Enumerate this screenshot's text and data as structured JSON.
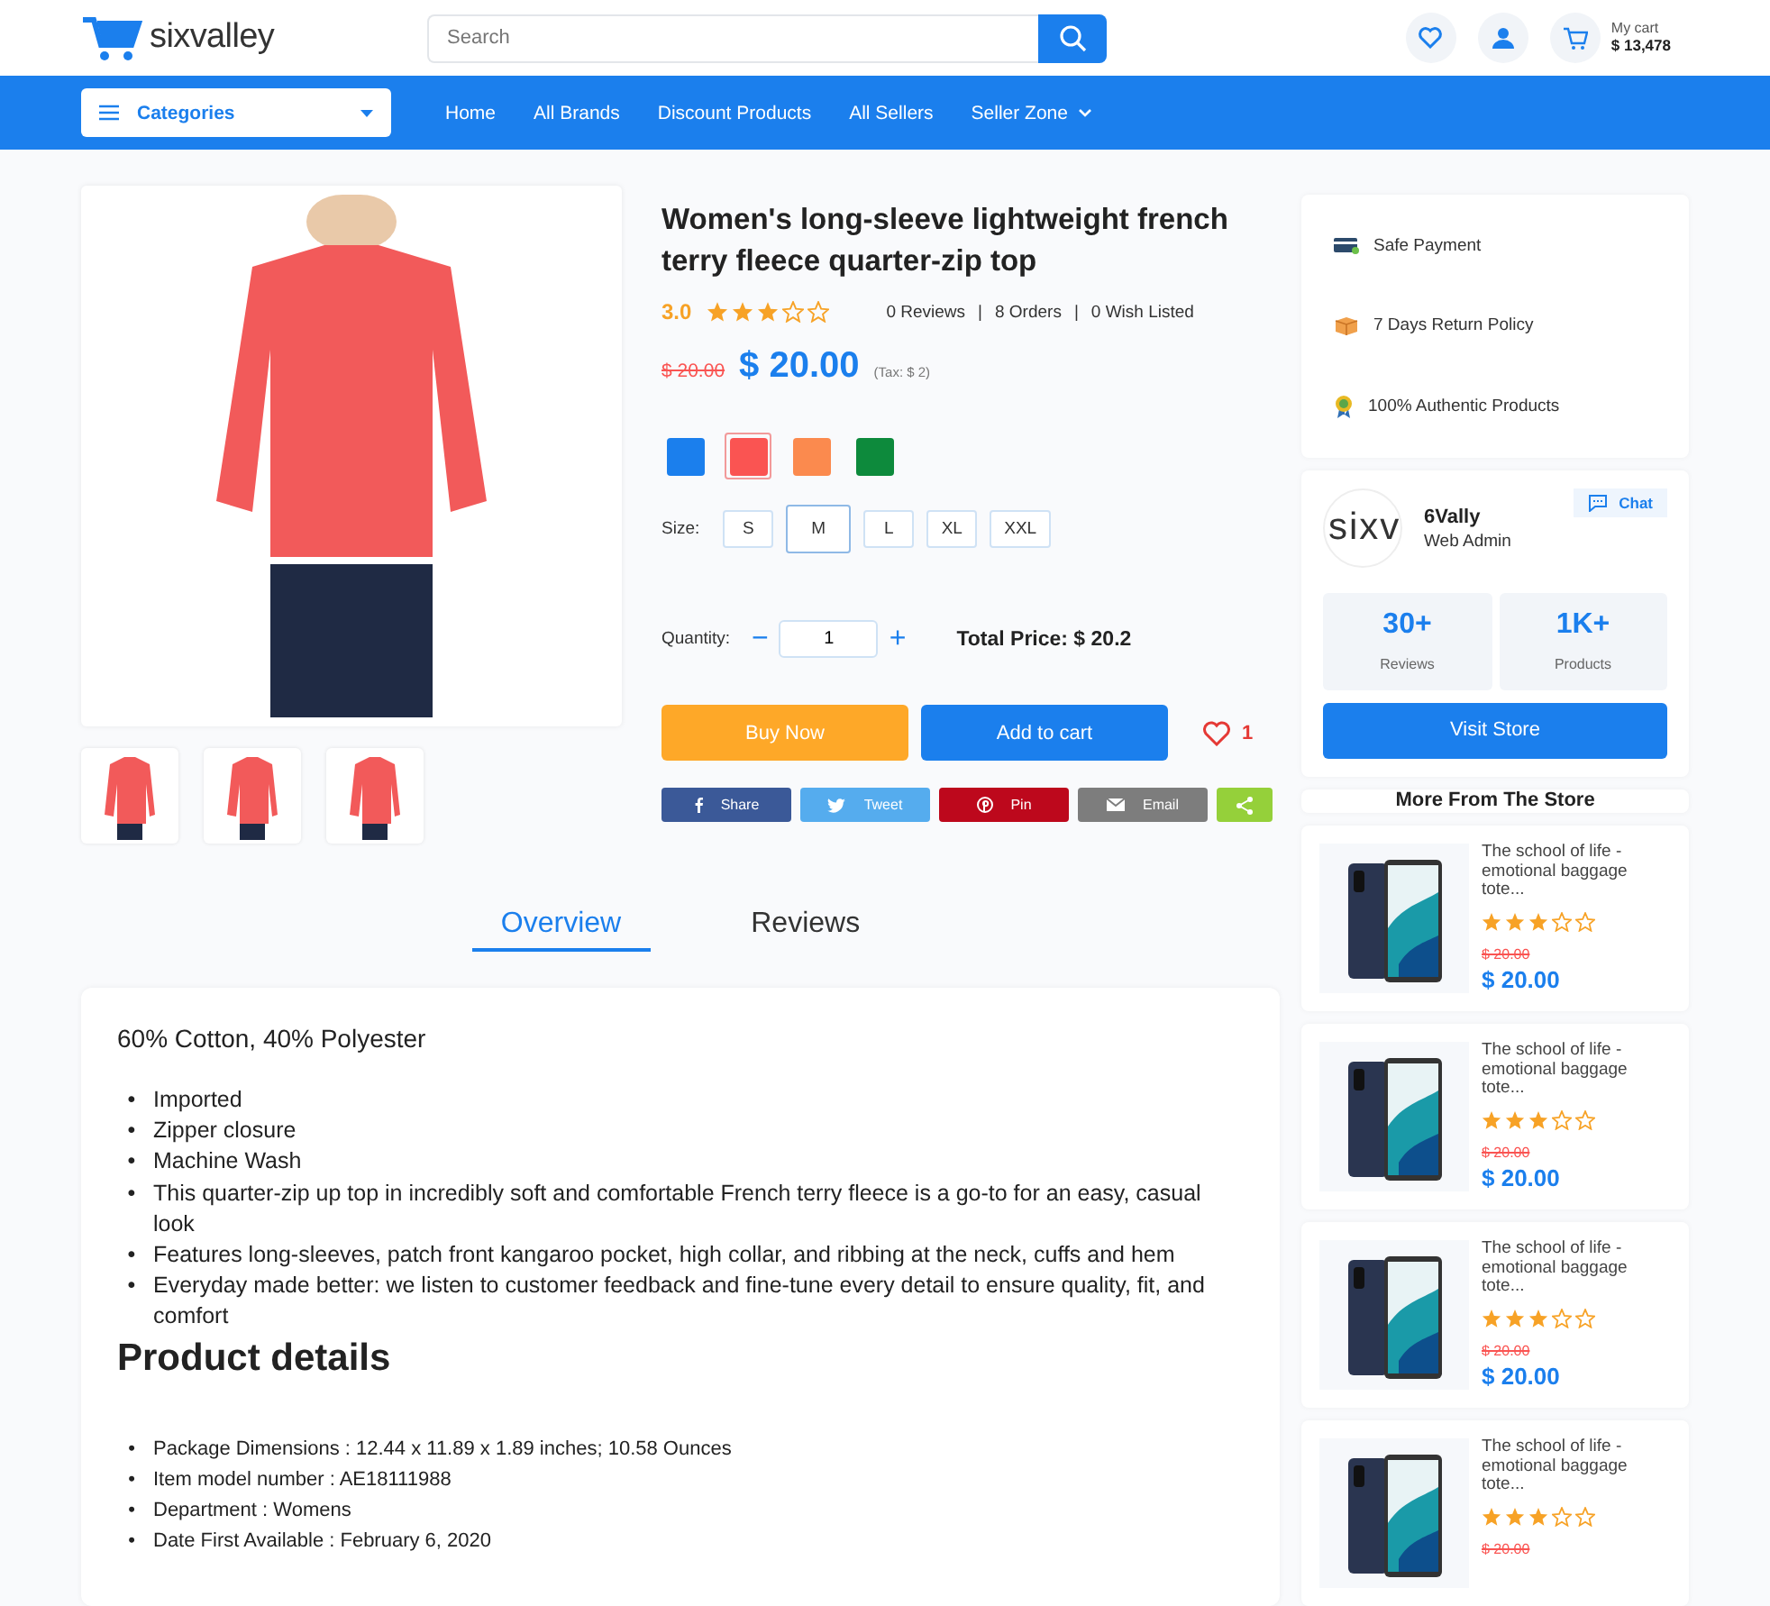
{
  "header": {
    "logo_text": "sixvalley",
    "search": {
      "placeholder": "Search"
    },
    "cart": {
      "label": "My cart",
      "amount": "$ 13,478"
    }
  },
  "nav": {
    "categories": "Categories",
    "links": [
      {
        "label": "Home",
        "dropdown": false
      },
      {
        "label": "All Brands",
        "dropdown": false
      },
      {
        "label": "Discount Products",
        "dropdown": false
      },
      {
        "label": "All Sellers",
        "dropdown": false
      },
      {
        "label": "Seller Zone",
        "dropdown": true
      }
    ]
  },
  "product": {
    "title": "Women's long-sleeve lightweight french terry fleece quarter-zip top",
    "rating": "3.0",
    "stars": 3,
    "stats": [
      "0 Reviews",
      "8 Orders",
      "0 Wish Listed"
    ],
    "stat_separator": "|",
    "old_price": "$ 20.00",
    "price": "$ 20.00",
    "tax": "(Tax: $ 2)",
    "colors": [
      {
        "color": "#1b7fed",
        "selected": false
      },
      {
        "color": "#fa5452",
        "selected": true
      },
      {
        "color": "#fb8a4e",
        "selected": false
      },
      {
        "color": "#0d8a3c",
        "selected": false
      }
    ],
    "size_label": "Size:",
    "sizes": [
      {
        "label": "S",
        "selected": false
      },
      {
        "label": "M",
        "selected": true
      },
      {
        "label": "L",
        "selected": false
      },
      {
        "label": "XL",
        "selected": false
      },
      {
        "label": "XXL",
        "selected": false
      }
    ],
    "quantity_label": "Quantity:",
    "quantity": "1",
    "minus": "−",
    "plus": "+",
    "total": "Total Price: $ 20.2",
    "buy_now": "Buy Now",
    "add_to_cart": "Add to cart",
    "wishlist_count": "1",
    "share": [
      {
        "kind": "facebook",
        "label": "Share",
        "color": "#3b5998"
      },
      {
        "kind": "twitter",
        "label": "Tweet",
        "color": "#55acee"
      },
      {
        "kind": "pinterest",
        "label": "Pin",
        "color": "#bd081c"
      },
      {
        "kind": "email",
        "label": "Email",
        "color": "#7d7d7d"
      },
      {
        "kind": "share",
        "color": "#95d03a"
      }
    ]
  },
  "tabs": [
    {
      "label": "Overview",
      "selected": true
    },
    {
      "label": "Reviews",
      "selected": false
    }
  ],
  "description": {
    "bullet": "•",
    "heading": "60% Cotton, 40% Polyester",
    "bullets": [
      "Imported",
      "Zipper closure",
      "Machine Wash",
      "This quarter-zip up top in incredibly soft and comfortable French terry fleece is a go-to for an easy, casual look",
      "Features long-sleeves, patch front kangaroo pocket, high collar, and ribbing at the neck, cuffs and hem",
      "Everyday made better: we listen to customer feedback and fine-tune every detail to ensure quality, fit, and comfort"
    ],
    "details_heading": "Product details",
    "details": [
      "Package Dimensions : 12.44 x 11.89 x 1.89 inches; 10.58 Ounces",
      "Item model number : AE18111988",
      "Department : Womens",
      "Date First Available : February 6, 2020"
    ]
  },
  "features": [
    {
      "kind": "payment",
      "label": "Safe Payment"
    },
    {
      "kind": "return",
      "label": "7 Days Return Policy"
    },
    {
      "kind": "authentic",
      "label": "100% Authentic Products"
    }
  ],
  "store": {
    "logo_text": "sixv",
    "name": "6Vally",
    "role": "Web Admin",
    "chat": "Chat",
    "stats": [
      {
        "value": "30+",
        "label": "Reviews"
      },
      {
        "value": "1K+",
        "label": "Products"
      }
    ],
    "visit": "Visit Store"
  },
  "more_title": "More From The Store",
  "more_items": [
    {
      "name": "The school of life - emotional baggage tote...",
      "stars": 3,
      "old_price": "$ 20.00",
      "price": "$ 20.00"
    },
    {
      "name": "The school of life - emotional baggage tote...",
      "stars": 3,
      "old_price": "$ 20.00",
      "price": "$ 20.00"
    },
    {
      "name": "The school of life - emotional baggage tote...",
      "stars": 3,
      "old_price": "$ 20.00",
      "price": "$ 20.00"
    },
    {
      "name": "The school of life - emotional baggage tote...",
      "stars": 3,
      "old_price": "$ 20.00"
    }
  ]
}
